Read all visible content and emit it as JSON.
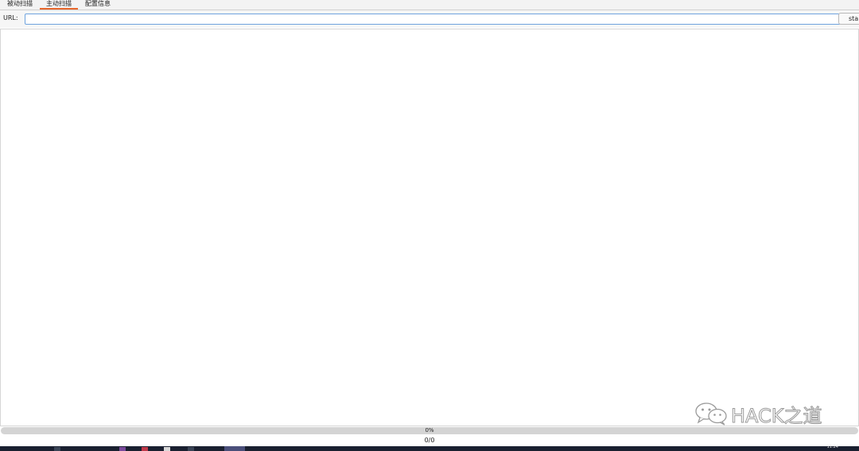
{
  "tabs": [
    {
      "label": "被动扫描",
      "active": false
    },
    {
      "label": "主动扫描",
      "active": true
    },
    {
      "label": "配置信息",
      "active": false
    }
  ],
  "toolbar": {
    "url_label": "URL:",
    "url_value": "",
    "start_label": "start"
  },
  "progress": {
    "percent_text": "0%",
    "fraction": 0,
    "count_text": "0/0"
  },
  "taskbar": {
    "clock": "11:24"
  },
  "watermark": {
    "text": "HACK之道",
    "icon": "wechat-icon"
  },
  "colors": {
    "tab_active_underline": "#e8672c",
    "input_border": "#6fa3de",
    "progress_track": "#d4d4d4",
    "taskbar": "#1a2030"
  }
}
